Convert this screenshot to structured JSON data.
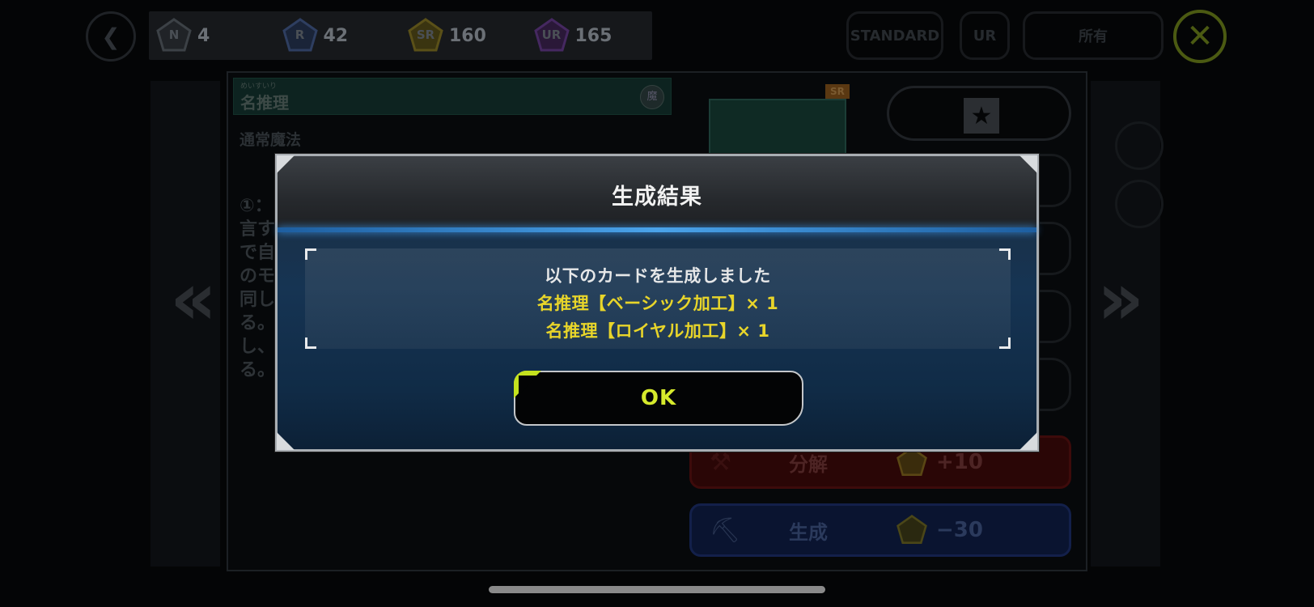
{
  "currency": {
    "n": {
      "label": "N",
      "value": "4"
    },
    "r": {
      "label": "R",
      "value": "42"
    },
    "sr": {
      "label": "SR",
      "value": "160"
    },
    "ur": {
      "label": "UR",
      "value": "165"
    }
  },
  "top_buttons": {
    "back_icon": "back-arrow-icon",
    "standard_label": "STANDARD",
    "ur_label": "UR",
    "owned_label": "所有",
    "close_icon": "close-icon"
  },
  "card": {
    "ruby": "めいすいり",
    "name": "名推理",
    "attribute": "魔",
    "type": "通常魔法",
    "text_lines": [
      "①：",
      "言す",
      "で自",
      "のモ",
      "同し",
      "る。",
      "し、",
      "る。"
    ],
    "rarity": "SR"
  },
  "actions": {
    "dismantle_label": "分解",
    "dismantle_value": "+10",
    "dismantle_rarity": "SR",
    "craft_label": "生成",
    "craft_value": "−30",
    "craft_rarity": "SR"
  },
  "modal": {
    "title": "生成結果",
    "message": "以下のカードを生成しました",
    "line1": "名推理【ベーシック加工】× 1",
    "line2": "名推理【ロイヤル加工】× 1",
    "ok_label": "OK"
  },
  "colors": {
    "accent_yellow": "#e8d52a",
    "ok_text": "#d6ea2c",
    "rule_blue": "#4aa3ea"
  }
}
